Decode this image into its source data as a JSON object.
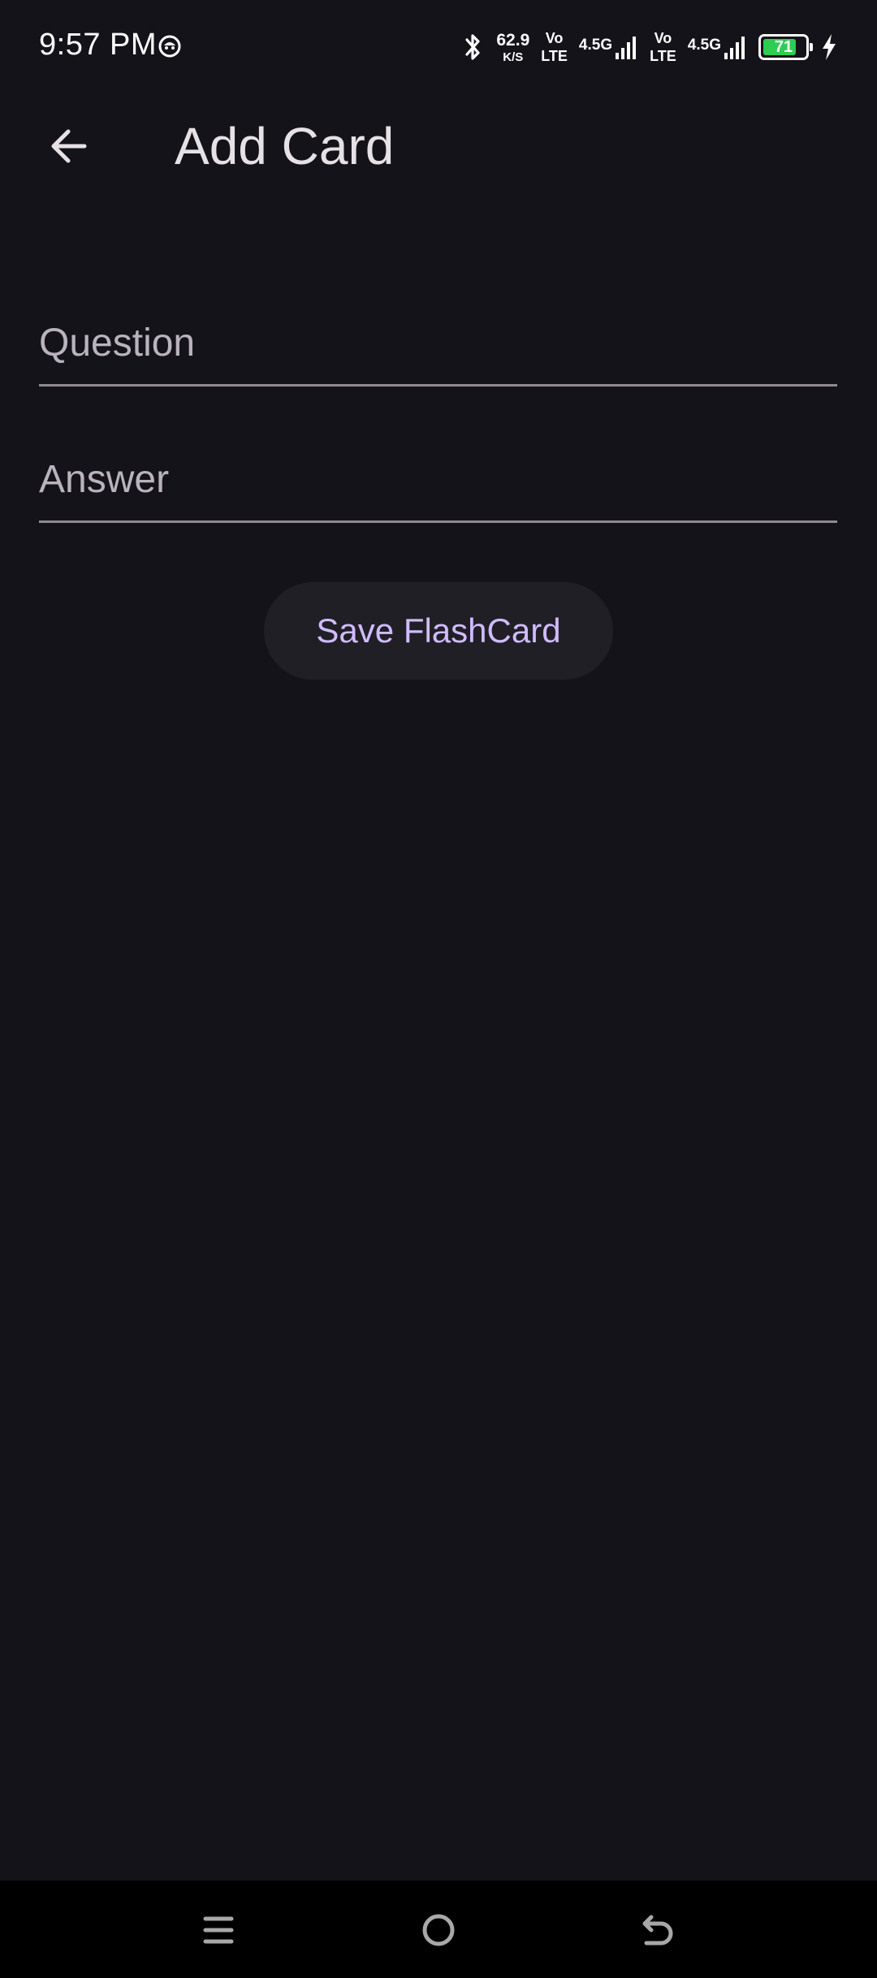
{
  "status_bar": {
    "time": "9:57 PM",
    "net_speed_value": "62.9",
    "net_speed_unit": "K/S",
    "sim1_volte_top": "Vo",
    "sim1_volte_bottom": "LTE",
    "sim1_network": "4.5G",
    "sim2_volte_top": "Vo",
    "sim2_volte_bottom": "LTE",
    "sim2_network": "4.5G",
    "battery_level": "71",
    "battery_color": "#2ecc52"
  },
  "app_bar": {
    "back_icon": "arrow-back-icon",
    "title": "Add Card"
  },
  "form": {
    "question_placeholder": "Question",
    "question_value": "",
    "answer_placeholder": "Answer",
    "answer_value": ""
  },
  "actions": {
    "save_label": "Save FlashCard",
    "accent_color": "#d0bcff"
  },
  "nav_bar": {
    "menu_icon": "menu-icon",
    "home_icon": "home-icon",
    "back_icon": "back-icon"
  }
}
